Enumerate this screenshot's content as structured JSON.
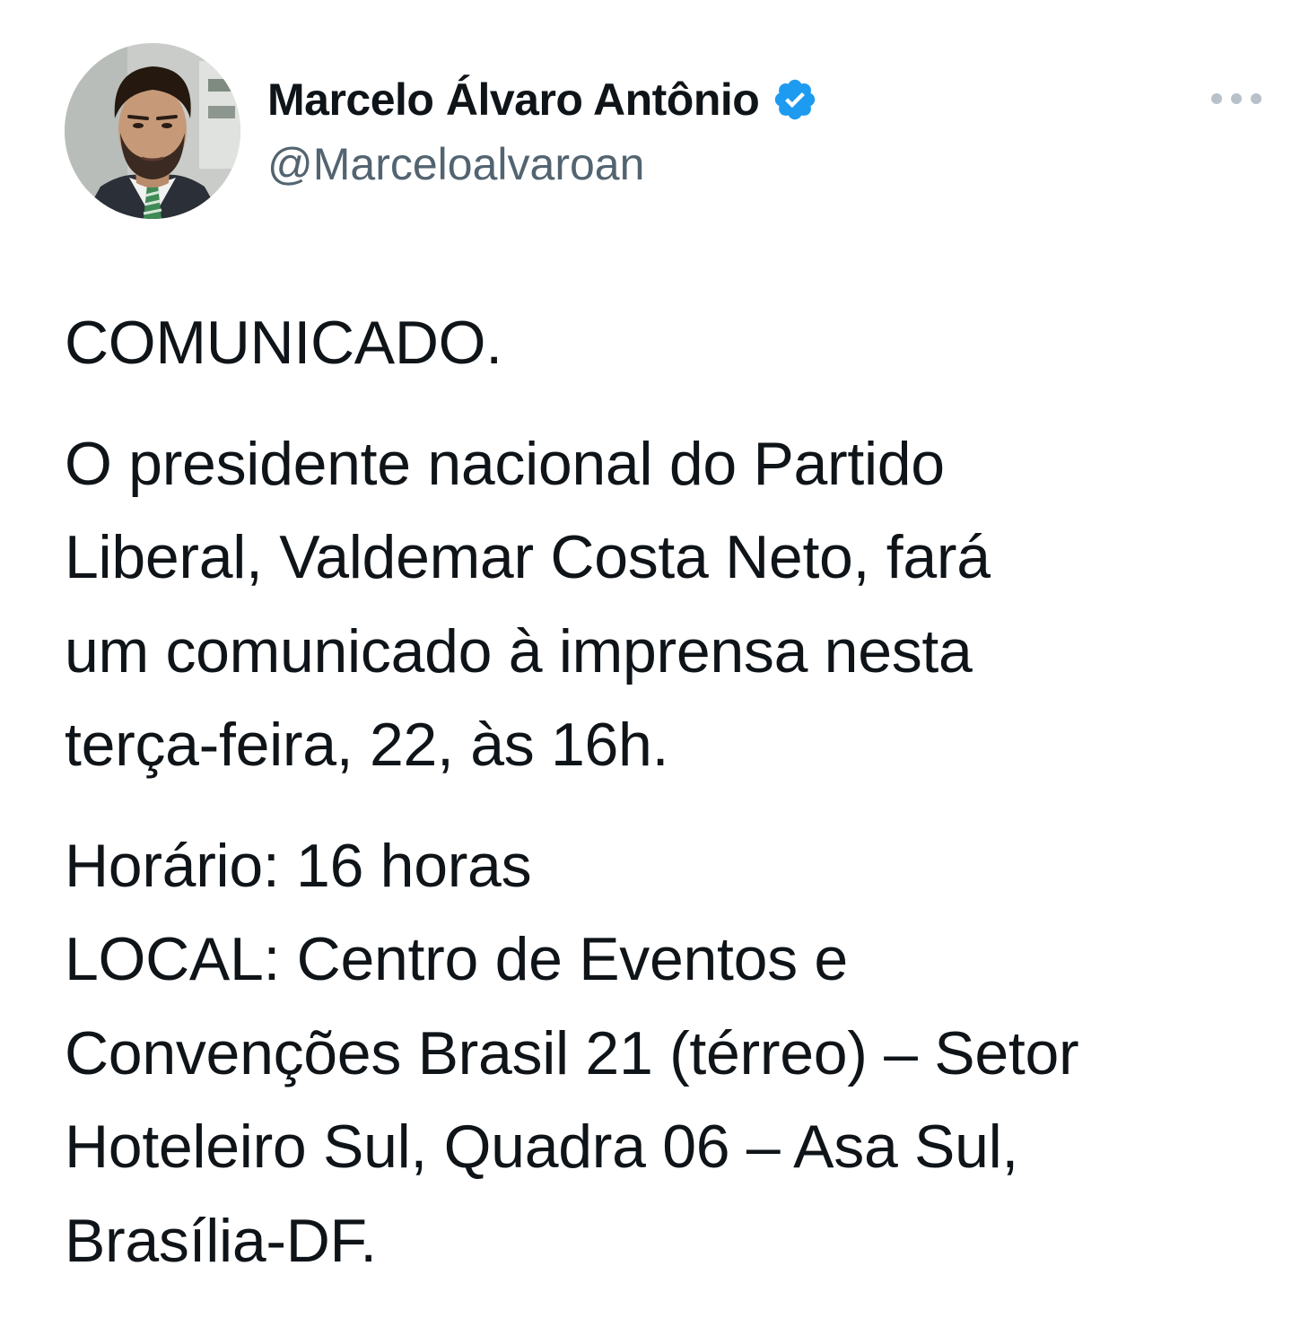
{
  "author": {
    "display_name": "Marcelo Álvaro Antônio",
    "handle": "@Marceloalvaroan",
    "verified": true,
    "verified_icon": "verified-badge-icon",
    "verified_color": "#1d9bf0",
    "avatar_alt": "profile photo"
  },
  "menu": {
    "icon": "more-horizontal-icon"
  },
  "tweet": {
    "paragraphs": [
      "COMUNICADO.",
      "O presidente nacional do Partido\nLiberal, Valdemar Costa Neto, fará\num comunicado à imprensa nesta\nterça-feira, 22, às 16h.",
      "Horário: 16 horas\nLOCAL: Centro de Eventos e\nConvenções Brasil 21 (térreo) – Setor\nHoteleiro Sul, Quadra 06 – Asa Sul,\nBrasília-DF."
    ]
  }
}
